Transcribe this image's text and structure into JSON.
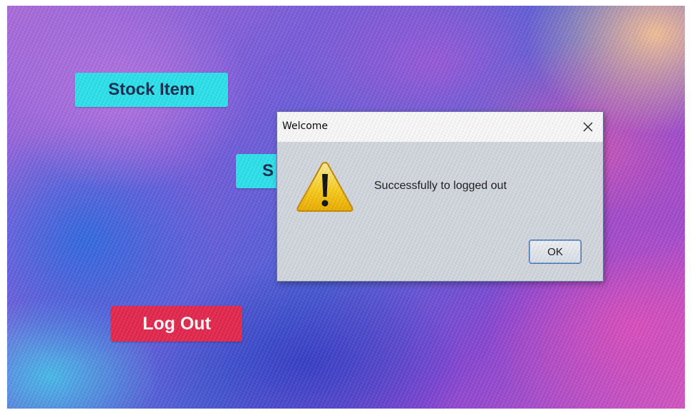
{
  "app": {
    "buttons": {
      "stock_item": "Stock Item",
      "partially_hidden": "S",
      "log_out": "Log Out"
    }
  },
  "dialog": {
    "title": "Welcome",
    "message": "Successfully to logged out",
    "ok_label": "OK",
    "icon": "warning-icon",
    "close_icon": "close-icon"
  },
  "colors": {
    "stock_button": "#2ee6f2",
    "logout_button": "#e8294f",
    "dialog_background": "#d7dbe3"
  }
}
